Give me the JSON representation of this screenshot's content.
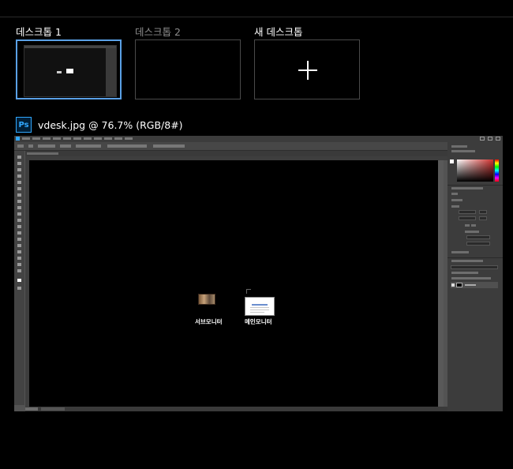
{
  "desktops": [
    {
      "label": "데스크톱 1",
      "state": "active"
    },
    {
      "label": "데스크톱 2",
      "state": "inactive"
    },
    {
      "label": "새 데스크톱",
      "state": "new"
    }
  ],
  "window": {
    "app_icon_text": "Ps",
    "app_icon": "photoshop-icon",
    "title": "vdesk.jpg @ 76.7% (RGB/8#)",
    "canvas": {
      "monitors": [
        {
          "label": "서브모니터"
        },
        {
          "label": "메인모니터"
        }
      ]
    }
  },
  "colors": {
    "selection_border": "#5aa0e6",
    "photoshop_blue": "#31a8ff",
    "background": "#000000"
  }
}
